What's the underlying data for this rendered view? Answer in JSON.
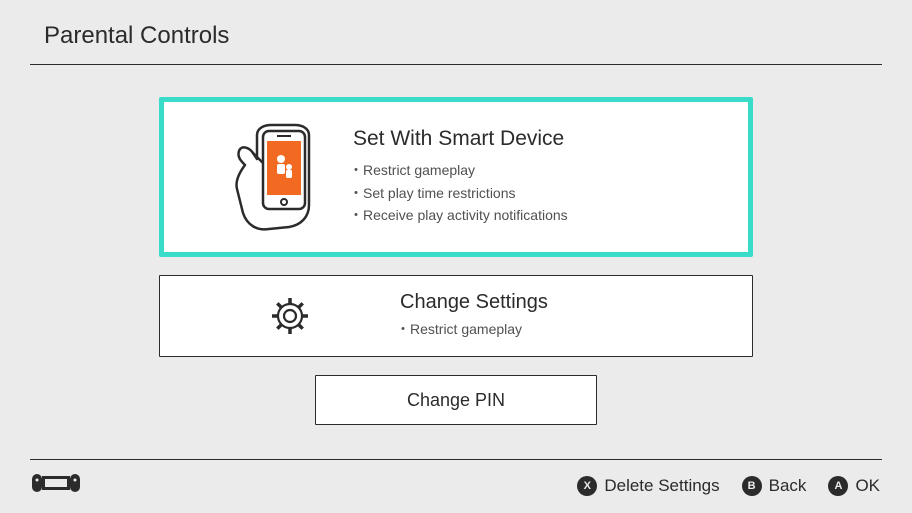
{
  "header": {
    "title": "Parental Controls"
  },
  "main": {
    "smart_device": {
      "title": "Set With Smart Device",
      "bullets": [
        "Restrict gameplay",
        "Set play time restrictions",
        "Receive play activity notifications"
      ]
    },
    "change_settings": {
      "title": "Change Settings",
      "bullets": [
        "Restrict gameplay"
      ]
    },
    "change_pin": {
      "title": "Change PIN"
    }
  },
  "footer": {
    "delete": {
      "button": "X",
      "label": "Delete Settings"
    },
    "back": {
      "button": "B",
      "label": "Back"
    },
    "ok": {
      "button": "A",
      "label": "OK"
    }
  }
}
